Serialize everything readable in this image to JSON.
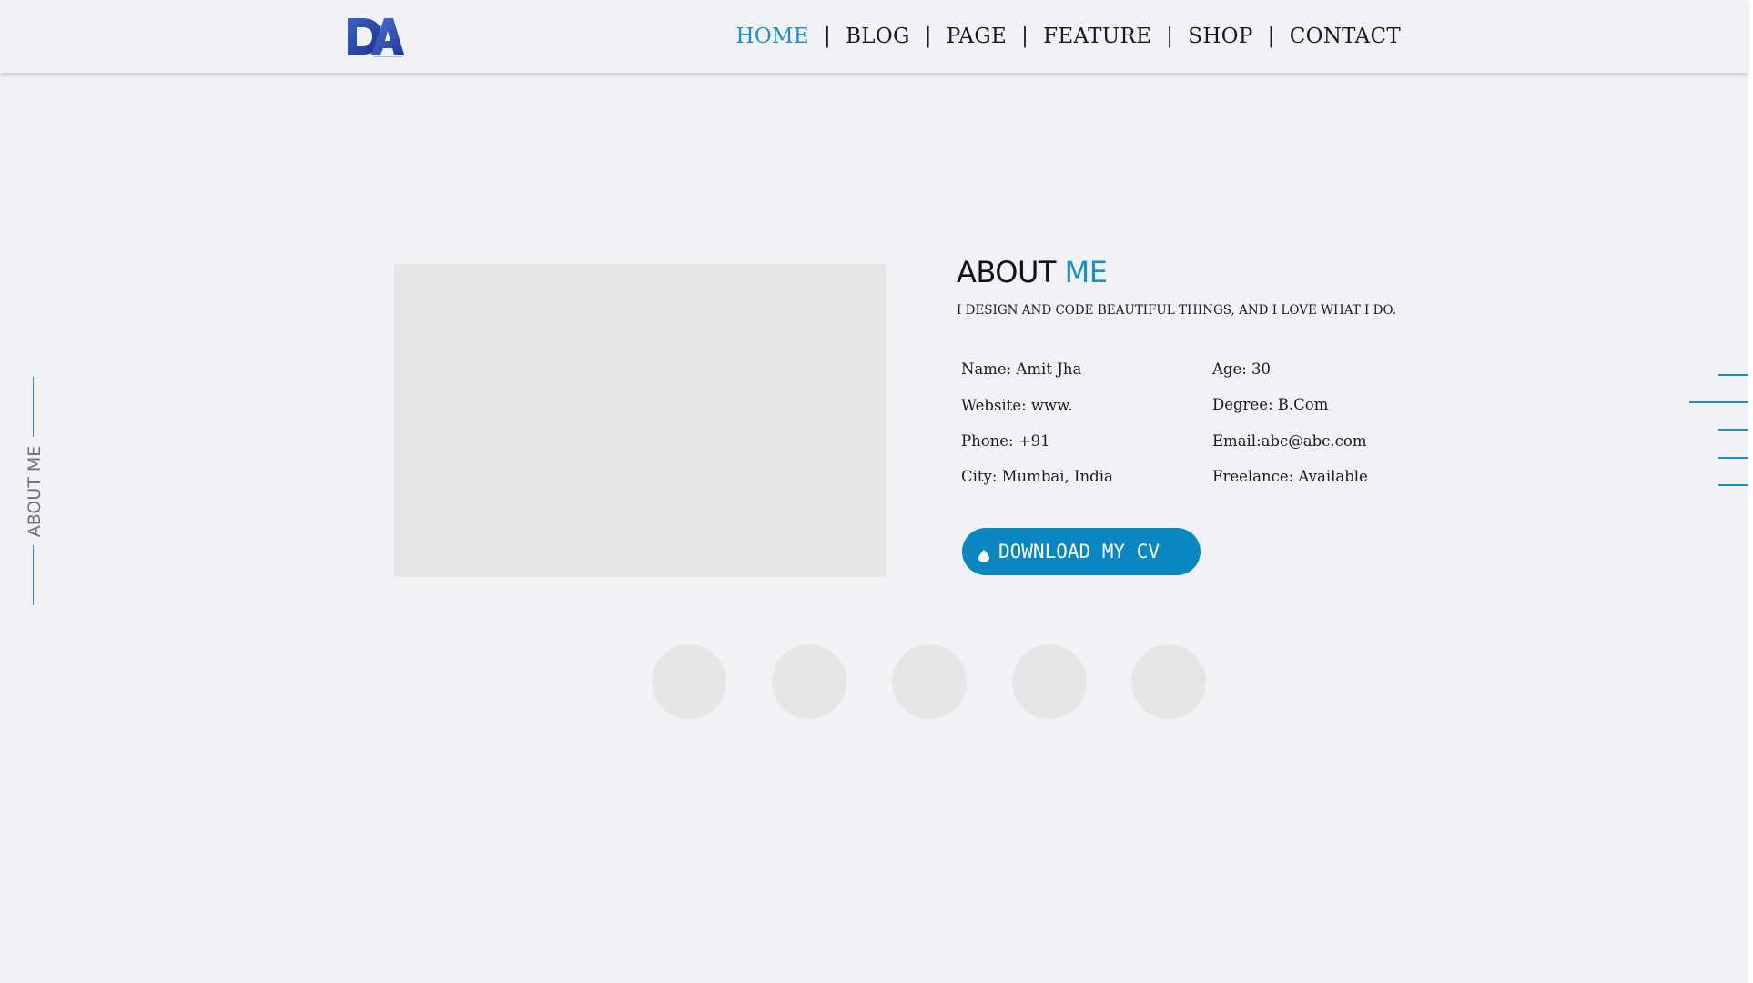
{
  "header": {
    "logo_text": "DA",
    "nav": [
      {
        "label": "HOME",
        "active": true
      },
      {
        "label": "BLOG",
        "active": false
      },
      {
        "label": "PAGE",
        "active": false
      },
      {
        "label": "FEATURE",
        "active": false
      },
      {
        "label": "SHOP",
        "active": false
      },
      {
        "label": "CONTACT",
        "active": false
      }
    ],
    "separator": "|"
  },
  "side": {
    "label": "ABOUT ME"
  },
  "about": {
    "title_main": "ABOUT",
    "title_accent": "ME",
    "subtitle": "I DESIGN AND CODE BEAUTIFUL THINGS, AND I LOVE WHAT I DO.",
    "info_left": [
      "Name: Amit Jha",
      "Website: www.",
      "Phone: +91",
      "City: Mumbai, India"
    ],
    "info_right": [
      "Age: 30",
      "Degree: B.Com",
      "Email:abc@abc.com",
      "Freelance: Available"
    ],
    "cv_button": "DOWNLOAD MY CV",
    "cv_icon": "drop-icon"
  },
  "colors": {
    "accent": "#1c8fc3",
    "button": "#0a86c1",
    "background": "#f1f2f6",
    "placeholder": "#e6e6e6"
  }
}
